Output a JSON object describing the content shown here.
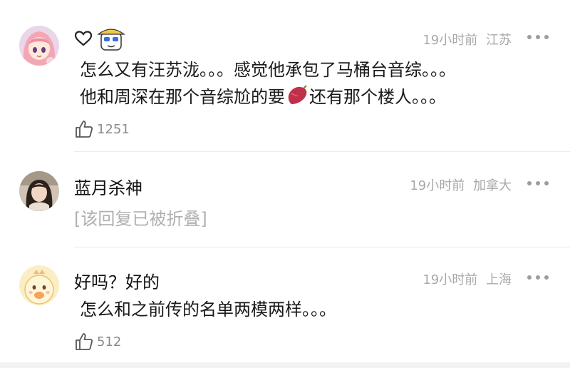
{
  "comments": [
    {
      "username": "",
      "timestamp": "19小时前",
      "location": "江苏",
      "lines": [
        "怎么又有汪苏泷。。。感觉他承包了马桶台音综。。。",
        "他和周深在那个音综尬的要",
        "还有那个楼人。。。"
      ],
      "inline_emoji": "sweet-potato-icon",
      "likes": "1251",
      "badges": [
        "heart-outline-icon",
        "cartoon-sticker-icon"
      ]
    },
    {
      "username": "蓝月杀神",
      "timestamp": "19小时前",
      "location": "加拿大",
      "folded_text": "[该回复已被折叠]"
    },
    {
      "username": "好吗？好的",
      "timestamp": "19小时前",
      "location": "上海",
      "lines": [
        "怎么和之前传的名单两模两样。。。"
      ],
      "likes": "512"
    }
  ],
  "colors": {
    "meta_gray": "#a8a8a8",
    "folded_gray": "#b0b0b0",
    "divider": "#ececec",
    "sweet_potato": "#c0304a"
  }
}
